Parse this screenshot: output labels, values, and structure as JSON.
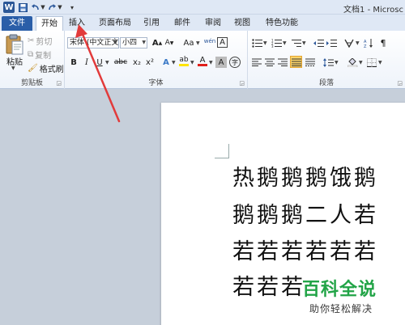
{
  "title_bar": {
    "app_icon_letter": "W",
    "document_title": "文档1 - Microsc"
  },
  "tabs": [
    {
      "label": "文件"
    },
    {
      "label": "开始"
    },
    {
      "label": "插入"
    },
    {
      "label": "页面布局"
    },
    {
      "label": "引用"
    },
    {
      "label": "邮件"
    },
    {
      "label": "审阅"
    },
    {
      "label": "视图"
    },
    {
      "label": "特色功能"
    }
  ],
  "clipboard": {
    "paste_label": "粘贴",
    "cut_label": "剪切",
    "copy_label": "复制",
    "format_painter_label": "格式刷",
    "group_label": "剪贴板"
  },
  "font": {
    "font_name": "宋体 (中文正文)",
    "font_size": "小四",
    "grow_glyph": "A",
    "shrink_glyph": "A",
    "change_case_glyph": "Aa",
    "pinyin_glyph": "wén",
    "border_char_glyph": "A",
    "bold_glyph": "B",
    "italic_glyph": "I",
    "underline_glyph": "U",
    "strike_glyph": "abc",
    "sub_glyph": "x₂",
    "sup_glyph": "x²",
    "text_effect_glyph": "A",
    "highlight_glyph": "ab",
    "font_color_glyph": "A",
    "char_shading_glyph": "A",
    "enclose_glyph": "字",
    "group_label": "字体"
  },
  "paragraph": {
    "group_label": "段落"
  },
  "document": {
    "lines": [
      "热鹅鹅鹅饿鹅",
      "鹅鹅鹅二人若",
      "若若若若若若",
      "若若若"
    ]
  },
  "watermark": {
    "logo_text": "百科全说",
    "slogan": "助你轻松解决"
  },
  "colors": {
    "file_tab": "#2a5ea8",
    "annotation_arrow": "#e23b3b",
    "watermark_green": "#22a447",
    "highlight_yellow": "#ffe400",
    "font_red": "#e0201b"
  }
}
